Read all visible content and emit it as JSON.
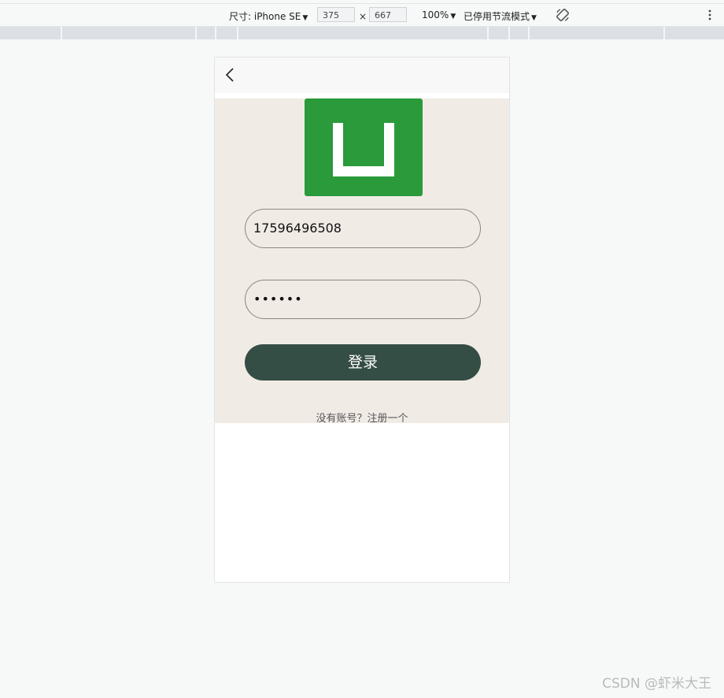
{
  "devtools": {
    "device_label": "尺寸: iPhone SE",
    "width_value": "375",
    "times_symbol": "×",
    "height_value": "667",
    "zoom_label": "100%",
    "throttle_label": "已停用节流模式",
    "caret": "▼"
  },
  "login": {
    "phone_value": "17596496508",
    "password_value": "••••••",
    "login_button_label": "登录",
    "register_link_text": "没有账号？注册一个"
  },
  "watermark": "CSDN @虾米大王",
  "colors": {
    "logo_green": "#2a9a3a",
    "login_bg": "#f1ebe6",
    "button_dark": "#354e45"
  }
}
